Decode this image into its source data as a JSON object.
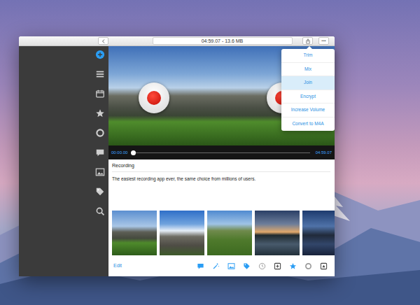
{
  "window": {
    "title": "04:59.07 - 13.6 MB",
    "more": "•••"
  },
  "sidebar": {
    "items": [
      {
        "selected": true
      },
      {
        "selected": false
      },
      {
        "selected": false
      },
      {
        "selected": false
      },
      {
        "selected": false
      },
      {
        "selected": false
      },
      {
        "selected": false
      },
      {
        "selected": false
      },
      {
        "selected": false
      }
    ]
  },
  "player": {
    "elapsed": "00:00.00",
    "duration": "04:59.07",
    "level": 0
  },
  "recording": {
    "title": "Recording",
    "description": "The easiest recording app ever, the same choice from millions of users."
  },
  "menu": {
    "items": [
      {
        "label": "Trim",
        "selected": false
      },
      {
        "label": "Mix",
        "selected": false
      },
      {
        "label": "Join",
        "selected": true
      },
      {
        "label": "Encrypt",
        "selected": false
      },
      {
        "label": "Increase Volume",
        "selected": false
      },
      {
        "label": "Convert to M4A",
        "selected": false
      }
    ]
  },
  "toolbar": {
    "edit": "Edit"
  }
}
